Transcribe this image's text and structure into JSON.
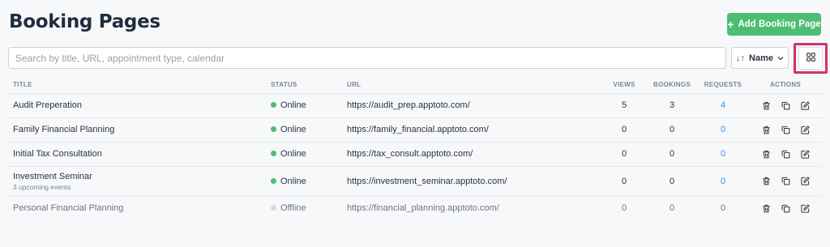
{
  "header": {
    "title": "Booking Pages",
    "add_button_label": "Add Booking Page",
    "add_icon": "plus-icon"
  },
  "search": {
    "placeholder": "Search by title, URL, appointment type, calendar",
    "value": ""
  },
  "sort": {
    "label": "Name",
    "icon": "sort-arrows-icon"
  },
  "view_toggle": {
    "icon": "grid-view-icon"
  },
  "table": {
    "columns": [
      "Title",
      "Status",
      "URL",
      "Views",
      "Bookings",
      "Requests",
      "Actions"
    ],
    "rows": [
      {
        "title": "Audit Preperation",
        "subtitle": "",
        "status": "Online",
        "url": "https://audit_prep.apptoto.com/",
        "views": "5",
        "bookings": "3",
        "requests": "4"
      },
      {
        "title": "Family Financial Planning",
        "subtitle": "",
        "status": "Online",
        "url": "https://family_financial.apptoto.com/",
        "views": "0",
        "bookings": "0",
        "requests": "0"
      },
      {
        "title": "Initial Tax Consultation",
        "subtitle": "",
        "status": "Online",
        "url": "https://tax_consult.apptoto.com/",
        "views": "0",
        "bookings": "0",
        "requests": "0"
      },
      {
        "title": "Investment Seminar",
        "subtitle": "3 upcoming events",
        "status": "Online",
        "url": "https://investment_seminar.apptoto.com/",
        "views": "0",
        "bookings": "0",
        "requests": "0"
      },
      {
        "title": "Personal Financial Planning",
        "subtitle": "",
        "status": "Offline",
        "url": "https://financial_planning.apptoto.com/",
        "views": "0",
        "bookings": "0",
        "requests": "0"
      }
    ]
  },
  "colors": {
    "accent_green": "#4dbd74",
    "link_blue": "#3a8fd9",
    "highlight_pink": "#d6306b"
  }
}
